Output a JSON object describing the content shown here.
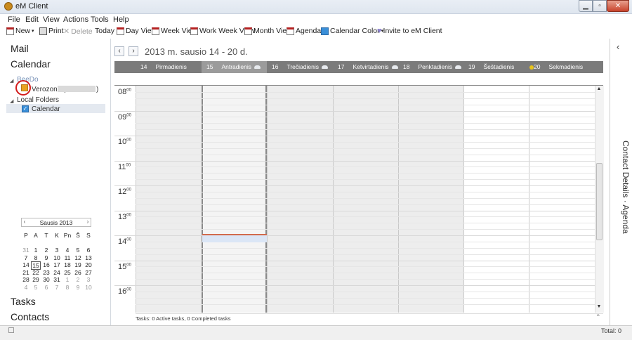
{
  "window": {
    "title": "eM Client",
    "min_icon": "minimize-icon",
    "max_icon": "maximize-icon",
    "close_icon": "close-icon"
  },
  "menu": [
    "File",
    "Edit",
    "View",
    "Actions",
    "Tools",
    "Help"
  ],
  "toolbar": {
    "new": "New",
    "print": "Print",
    "delete": "Delete",
    "today": "Today",
    "day_view": "Day View",
    "week_view": "Week View",
    "work_week_view": "Work Week View",
    "month_view": "Month View",
    "agenda": "Agenda",
    "calendar_color": "Calendar Color",
    "invite": "Invite to eM Client"
  },
  "nav": {
    "mail": "Mail",
    "calendar": "Calendar",
    "tasks": "Tasks",
    "contacts": "Contacts",
    "tree": {
      "account": "BeeDo",
      "calendar_name": "Verozona (",
      "calendar_close": ")",
      "local_folders": "Local Folders",
      "local_calendar": "Calendar"
    }
  },
  "minical": {
    "month": "Sausis 2013",
    "weekdays": [
      "P",
      "A",
      "T",
      "K",
      "Pn",
      "Š",
      "S"
    ],
    "weeks": [
      [
        "31",
        "1",
        "2",
        "3",
        "4",
        "5",
        "6"
      ],
      [
        "7",
        "8",
        "9",
        "10",
        "11",
        "12",
        "13"
      ],
      [
        "14",
        "15",
        "16",
        "17",
        "18",
        "19",
        "20"
      ],
      [
        "21",
        "22",
        "23",
        "24",
        "25",
        "26",
        "27"
      ],
      [
        "28",
        "29",
        "30",
        "31",
        "1",
        "2",
        "3"
      ],
      [
        "4",
        "5",
        "6",
        "7",
        "8",
        "9",
        "10"
      ]
    ],
    "today": "15"
  },
  "calendar": {
    "range": "2013 m. sausio 14 - 20 d.",
    "days": [
      {
        "num": "14",
        "name": "Pirmadienis",
        "weather": ""
      },
      {
        "num": "15",
        "name": "Antradienis",
        "weather": "cloud-icon"
      },
      {
        "num": "16",
        "name": "Trečiadienis",
        "weather": "cloud-icon"
      },
      {
        "num": "17",
        "name": "Ketvirtadienis",
        "weather": "cloud-icon"
      },
      {
        "num": "18",
        "name": "Penktadienis",
        "weather": "cloud-icon"
      },
      {
        "num": "19",
        "name": "Šeštadienis",
        "weather": "sun-icon"
      },
      {
        "num": "20",
        "name": "Sekmadienis",
        "weather": ""
      }
    ],
    "hours": [
      "08",
      "09",
      "10",
      "11",
      "12",
      "13",
      "14",
      "15",
      "16"
    ],
    "minutes": "00"
  },
  "tasks_bar": "Tasks: 0 Active tasks, 0 Completed tasks",
  "right_panel": {
    "label": "Contact Details  ·  Agenda"
  },
  "status": {
    "total": "Total: 0"
  }
}
